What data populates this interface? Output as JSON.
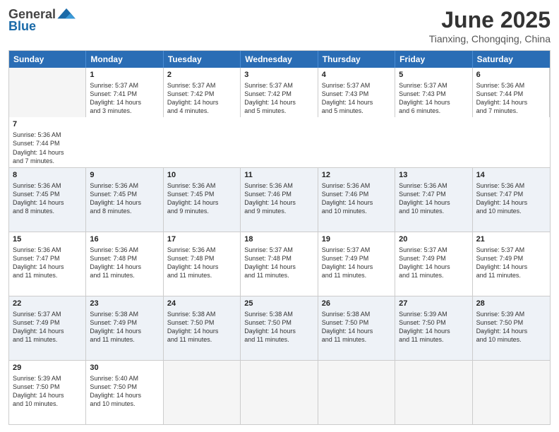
{
  "logo": {
    "general": "General",
    "blue": "Blue"
  },
  "title": "June 2025",
  "location": "Tianxing, Chongqing, China",
  "headers": [
    "Sunday",
    "Monday",
    "Tuesday",
    "Wednesday",
    "Thursday",
    "Friday",
    "Saturday"
  ],
  "rows": [
    [
      {
        "day": "",
        "empty": true,
        "lines": []
      },
      {
        "day": "1",
        "lines": [
          "Sunrise: 5:37 AM",
          "Sunset: 7:41 PM",
          "Daylight: 14 hours",
          "and 3 minutes."
        ]
      },
      {
        "day": "2",
        "lines": [
          "Sunrise: 5:37 AM",
          "Sunset: 7:42 PM",
          "Daylight: 14 hours",
          "and 4 minutes."
        ]
      },
      {
        "day": "3",
        "lines": [
          "Sunrise: 5:37 AM",
          "Sunset: 7:42 PM",
          "Daylight: 14 hours",
          "and 5 minutes."
        ]
      },
      {
        "day": "4",
        "lines": [
          "Sunrise: 5:37 AM",
          "Sunset: 7:43 PM",
          "Daylight: 14 hours",
          "and 5 minutes."
        ]
      },
      {
        "day": "5",
        "lines": [
          "Sunrise: 5:37 AM",
          "Sunset: 7:43 PM",
          "Daylight: 14 hours",
          "and 6 minutes."
        ]
      },
      {
        "day": "6",
        "lines": [
          "Sunrise: 5:36 AM",
          "Sunset: 7:44 PM",
          "Daylight: 14 hours",
          "and 7 minutes."
        ]
      },
      {
        "day": "7",
        "lines": [
          "Sunrise: 5:36 AM",
          "Sunset: 7:44 PM",
          "Daylight: 14 hours",
          "and 7 minutes."
        ]
      }
    ],
    [
      {
        "day": "8",
        "lines": [
          "Sunrise: 5:36 AM",
          "Sunset: 7:45 PM",
          "Daylight: 14 hours",
          "and 8 minutes."
        ]
      },
      {
        "day": "9",
        "lines": [
          "Sunrise: 5:36 AM",
          "Sunset: 7:45 PM",
          "Daylight: 14 hours",
          "and 8 minutes."
        ]
      },
      {
        "day": "10",
        "lines": [
          "Sunrise: 5:36 AM",
          "Sunset: 7:45 PM",
          "Daylight: 14 hours",
          "and 9 minutes."
        ]
      },
      {
        "day": "11",
        "lines": [
          "Sunrise: 5:36 AM",
          "Sunset: 7:46 PM",
          "Daylight: 14 hours",
          "and 9 minutes."
        ]
      },
      {
        "day": "12",
        "lines": [
          "Sunrise: 5:36 AM",
          "Sunset: 7:46 PM",
          "Daylight: 14 hours",
          "and 10 minutes."
        ]
      },
      {
        "day": "13",
        "lines": [
          "Sunrise: 5:36 AM",
          "Sunset: 7:47 PM",
          "Daylight: 14 hours",
          "and 10 minutes."
        ]
      },
      {
        "day": "14",
        "lines": [
          "Sunrise: 5:36 AM",
          "Sunset: 7:47 PM",
          "Daylight: 14 hours",
          "and 10 minutes."
        ]
      }
    ],
    [
      {
        "day": "15",
        "lines": [
          "Sunrise: 5:36 AM",
          "Sunset: 7:47 PM",
          "Daylight: 14 hours",
          "and 11 minutes."
        ]
      },
      {
        "day": "16",
        "lines": [
          "Sunrise: 5:36 AM",
          "Sunset: 7:48 PM",
          "Daylight: 14 hours",
          "and 11 minutes."
        ]
      },
      {
        "day": "17",
        "lines": [
          "Sunrise: 5:36 AM",
          "Sunset: 7:48 PM",
          "Daylight: 14 hours",
          "and 11 minutes."
        ]
      },
      {
        "day": "18",
        "lines": [
          "Sunrise: 5:37 AM",
          "Sunset: 7:48 PM",
          "Daylight: 14 hours",
          "and 11 minutes."
        ]
      },
      {
        "day": "19",
        "lines": [
          "Sunrise: 5:37 AM",
          "Sunset: 7:49 PM",
          "Daylight: 14 hours",
          "and 11 minutes."
        ]
      },
      {
        "day": "20",
        "lines": [
          "Sunrise: 5:37 AM",
          "Sunset: 7:49 PM",
          "Daylight: 14 hours",
          "and 11 minutes."
        ]
      },
      {
        "day": "21",
        "lines": [
          "Sunrise: 5:37 AM",
          "Sunset: 7:49 PM",
          "Daylight: 14 hours",
          "and 11 minutes."
        ]
      }
    ],
    [
      {
        "day": "22",
        "lines": [
          "Sunrise: 5:37 AM",
          "Sunset: 7:49 PM",
          "Daylight: 14 hours",
          "and 11 minutes."
        ]
      },
      {
        "day": "23",
        "lines": [
          "Sunrise: 5:38 AM",
          "Sunset: 7:49 PM",
          "Daylight: 14 hours",
          "and 11 minutes."
        ]
      },
      {
        "day": "24",
        "lines": [
          "Sunrise: 5:38 AM",
          "Sunset: 7:50 PM",
          "Daylight: 14 hours",
          "and 11 minutes."
        ]
      },
      {
        "day": "25",
        "lines": [
          "Sunrise: 5:38 AM",
          "Sunset: 7:50 PM",
          "Daylight: 14 hours",
          "and 11 minutes."
        ]
      },
      {
        "day": "26",
        "lines": [
          "Sunrise: 5:38 AM",
          "Sunset: 7:50 PM",
          "Daylight: 14 hours",
          "and 11 minutes."
        ]
      },
      {
        "day": "27",
        "lines": [
          "Sunrise: 5:39 AM",
          "Sunset: 7:50 PM",
          "Daylight: 14 hours",
          "and 11 minutes."
        ]
      },
      {
        "day": "28",
        "lines": [
          "Sunrise: 5:39 AM",
          "Sunset: 7:50 PM",
          "Daylight: 14 hours",
          "and 10 minutes."
        ]
      }
    ],
    [
      {
        "day": "29",
        "lines": [
          "Sunrise: 5:39 AM",
          "Sunset: 7:50 PM",
          "Daylight: 14 hours",
          "and 10 minutes."
        ]
      },
      {
        "day": "30",
        "lines": [
          "Sunrise: 5:40 AM",
          "Sunset: 7:50 PM",
          "Daylight: 14 hours",
          "and 10 minutes."
        ]
      },
      {
        "day": "",
        "empty": true,
        "lines": []
      },
      {
        "day": "",
        "empty": true,
        "lines": []
      },
      {
        "day": "",
        "empty": true,
        "lines": []
      },
      {
        "day": "",
        "empty": true,
        "lines": []
      },
      {
        "day": "",
        "empty": true,
        "lines": []
      }
    ]
  ]
}
